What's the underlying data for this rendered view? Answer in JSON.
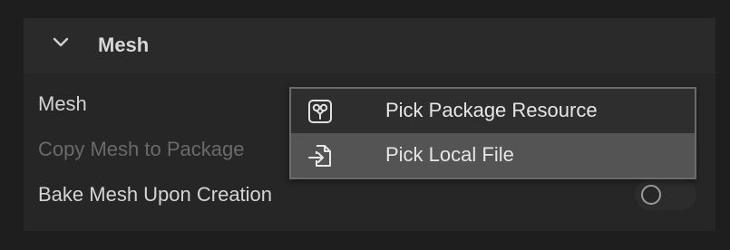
{
  "section": {
    "title": "Mesh",
    "expanded": true
  },
  "rows": {
    "mesh_label": "Mesh",
    "copy_label": "Copy Mesh to Package",
    "bake_label": "Bake Mesh Upon Creation",
    "bake_enabled": false
  },
  "menu": {
    "items": [
      {
        "label": "Pick Package Resource",
        "icon": "package-resource-icon"
      },
      {
        "label": "Pick Local File",
        "icon": "import-file-icon",
        "highlighted": true
      }
    ]
  },
  "colors": {
    "background": "#1e1e1e",
    "panel": "#262626",
    "menu_highlight": "#545454"
  }
}
